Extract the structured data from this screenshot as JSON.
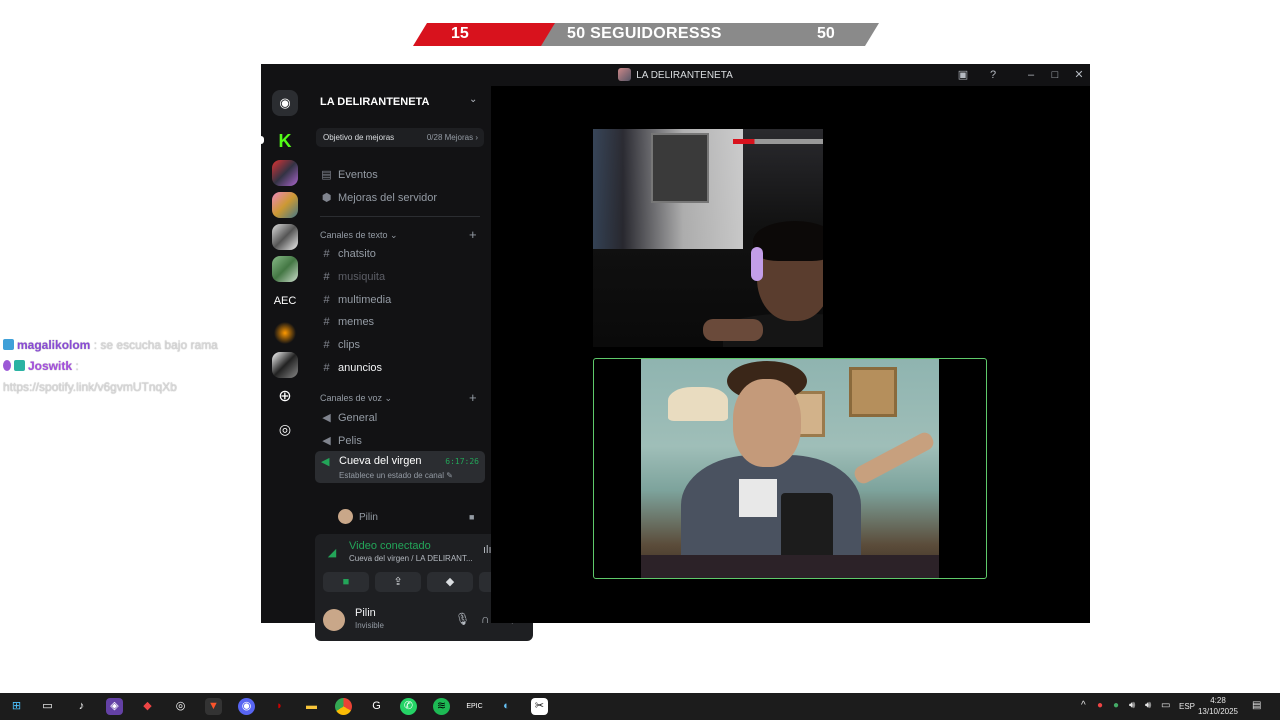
{
  "goal_banner": {
    "current": "15",
    "label": "50 SEGUIDORESSS",
    "target": "50",
    "colors": {
      "progress": "#d8121d",
      "remaining": "#8a8a8a"
    }
  },
  "chat_overlay": {
    "messages": [
      {
        "user": "magalikolom",
        "separator": ":",
        "text": "se escucha bajo rama"
      },
      {
        "user": "Joswitk",
        "separator": ":",
        "text": "https://spotify.link/v6gvmUTnqXb"
      }
    ]
  },
  "discord": {
    "window_title": "LA DELIRANTENETA",
    "titlebar_icons": [
      "inbox-icon",
      "help-icon",
      "minimize-icon",
      "maximize-icon",
      "close-icon"
    ],
    "guild_rail": {
      "items": [
        "discord-home",
        "kick-server",
        "server-2",
        "server-3",
        "server-4",
        "server-5",
        "AEC",
        "server-7",
        "server-8",
        "add-server",
        "explore"
      ],
      "aec_label": "AEC"
    },
    "server": {
      "name": "LA DELIRANTENETA",
      "boost_goal": {
        "label": "Objetivo de mejoras",
        "progress": "0/28 Mejoras",
        "chevron": "›"
      },
      "menu": [
        {
          "label": "Eventos",
          "icon": "calendar-icon"
        },
        {
          "label": "Mejoras del servidor",
          "icon": "boost-icon"
        }
      ],
      "text_category": "Canales de texto",
      "text_channels": [
        "chatsito",
        "musiquita",
        "multimedia",
        "memes",
        "clips",
        "anuncios"
      ],
      "voice_category": "Canales de voz",
      "voice_channels": [
        "General",
        "Pelis"
      ],
      "active_voice": {
        "name": "Cueva del virgen",
        "timer": "6:17:26",
        "status_placeholder": "Establece un estado de canal"
      },
      "member": {
        "name": "Pilin"
      }
    },
    "voice_panel": {
      "status": "Video conectado",
      "location": "Cueva del virgen / LA DELIRANT...",
      "buttons": [
        "camera-icon",
        "screen-share-icon",
        "activity-icon",
        "soundboard-icon"
      ]
    },
    "user_panel": {
      "name": "Pilin",
      "status": "Invisible"
    },
    "accent_colors": {
      "connected": "#23a559",
      "video_border": "#5ec96a",
      "bg": "#121214"
    }
  },
  "taskbar": {
    "apps": [
      "windows-start-icon",
      "task-view-icon",
      "tiktok-icon",
      "twitch-icon",
      "app-diamond-icon",
      "obs-icon",
      "brave-icon",
      "discord-icon",
      "app-red-icon",
      "file-explorer-icon",
      "chrome-icon",
      "app-g-icon",
      "whatsapp-icon",
      "spotify-icon",
      "epic-icon",
      "steam-icon",
      "capcut-icon"
    ],
    "tray_language": "ESP",
    "time": "4:28",
    "date": "13/10/2025"
  }
}
